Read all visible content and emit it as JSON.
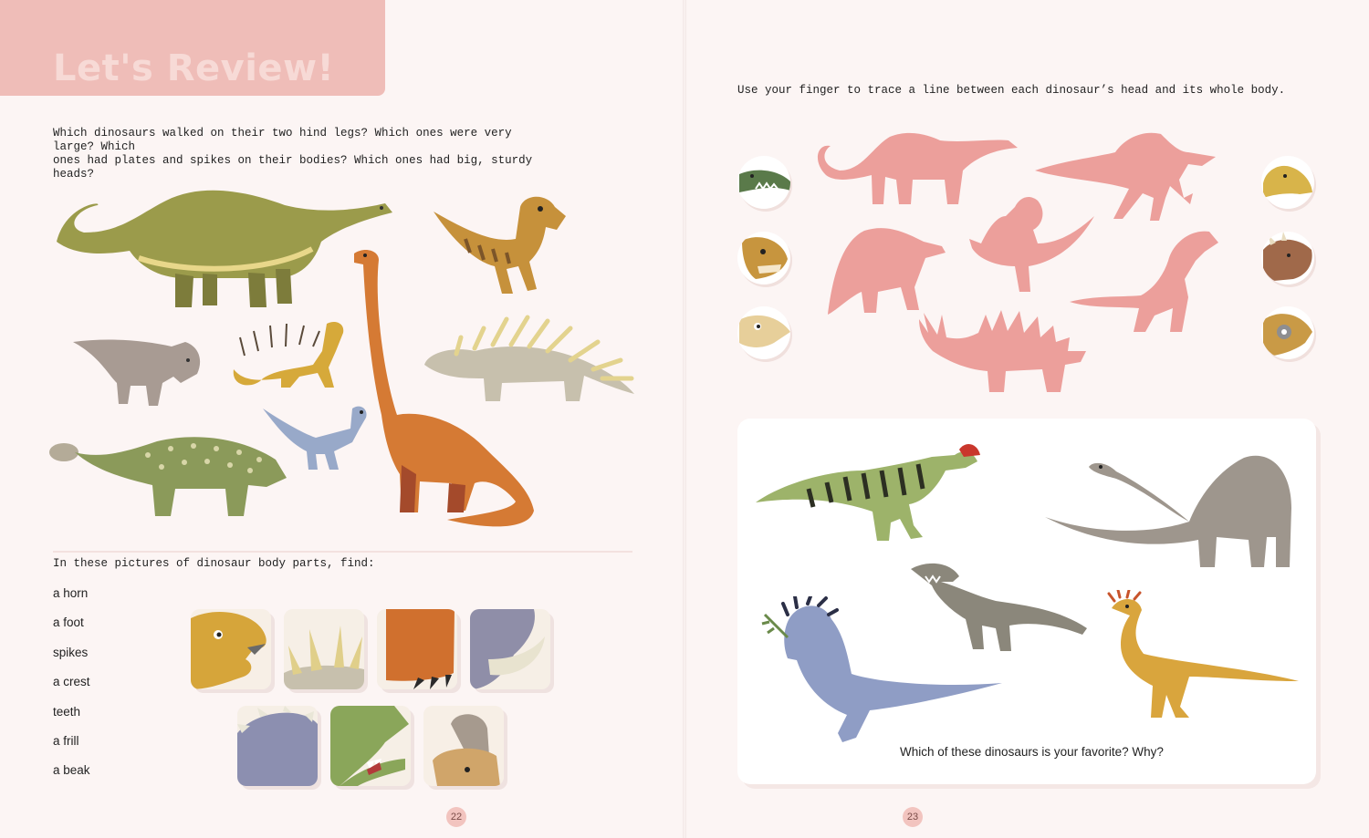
{
  "left_page": {
    "title": "Let's Review!",
    "intro_line1": "Which dinosaurs walked on their two hind legs? Which ones were very large? Which",
    "intro_line2": "ones had plates and spikes on their bodies? Which ones had big, sturdy heads?",
    "find_title": "In these pictures of dinosaur body parts, find:",
    "body_parts": [
      "a horn",
      "a foot",
      "spikes",
      "a crest",
      "teeth",
      "a frill",
      "a beak"
    ],
    "page_number": "22"
  },
  "right_page": {
    "trace_instruction": "Use your finger to trace a line between each dinosaur’s head and its whole body.",
    "favorite_question": "Which of these dinosaurs is your favorite? Why?",
    "page_number": "23"
  },
  "colors": {
    "title_tab": "#efbdb8",
    "silhouette": "#ec9f9b",
    "page_background": "#fcf5f4",
    "page_number_badge": "#f2c4bf"
  },
  "icons": {
    "left_illustrations": [
      "long-neck-sauropod-icon",
      "theropod-icon",
      "protoceratops-icon",
      "spiky-lizard-icon",
      "kentrosaurus-icon",
      "oviraptor-icon",
      "brachiosaurus-icon",
      "ankylosaurus-icon"
    ],
    "silhouettes": [
      "sauropod-silhouette-icon",
      "spinosaurus-silhouette-icon",
      "dimetrodon-like-silhouette-icon",
      "ceratosaurus-silhouette-icon",
      "tyrannosaur-silhouette-icon",
      "stegosaur-silhouette-icon"
    ],
    "head_circles": [
      "crocodile-head-icon",
      "theropod-head-icon",
      "beaked-head-icon",
      "duckbill-head-icon",
      "horned-head-icon",
      "armored-head-icon"
    ],
    "panel_illustrations": [
      "dilophosaurus-icon",
      "apatosaurus-icon",
      "velociraptor-icon",
      "pachycephalosaurus-icon",
      "compsognathus-icon"
    ],
    "body_part_tiles": [
      "beak-tile-icon",
      "spikes-tile-icon",
      "foot-tile-icon",
      "horn-tile-icon",
      "frill-tile-icon",
      "teeth-tile-icon",
      "crest-tile-icon"
    ]
  }
}
